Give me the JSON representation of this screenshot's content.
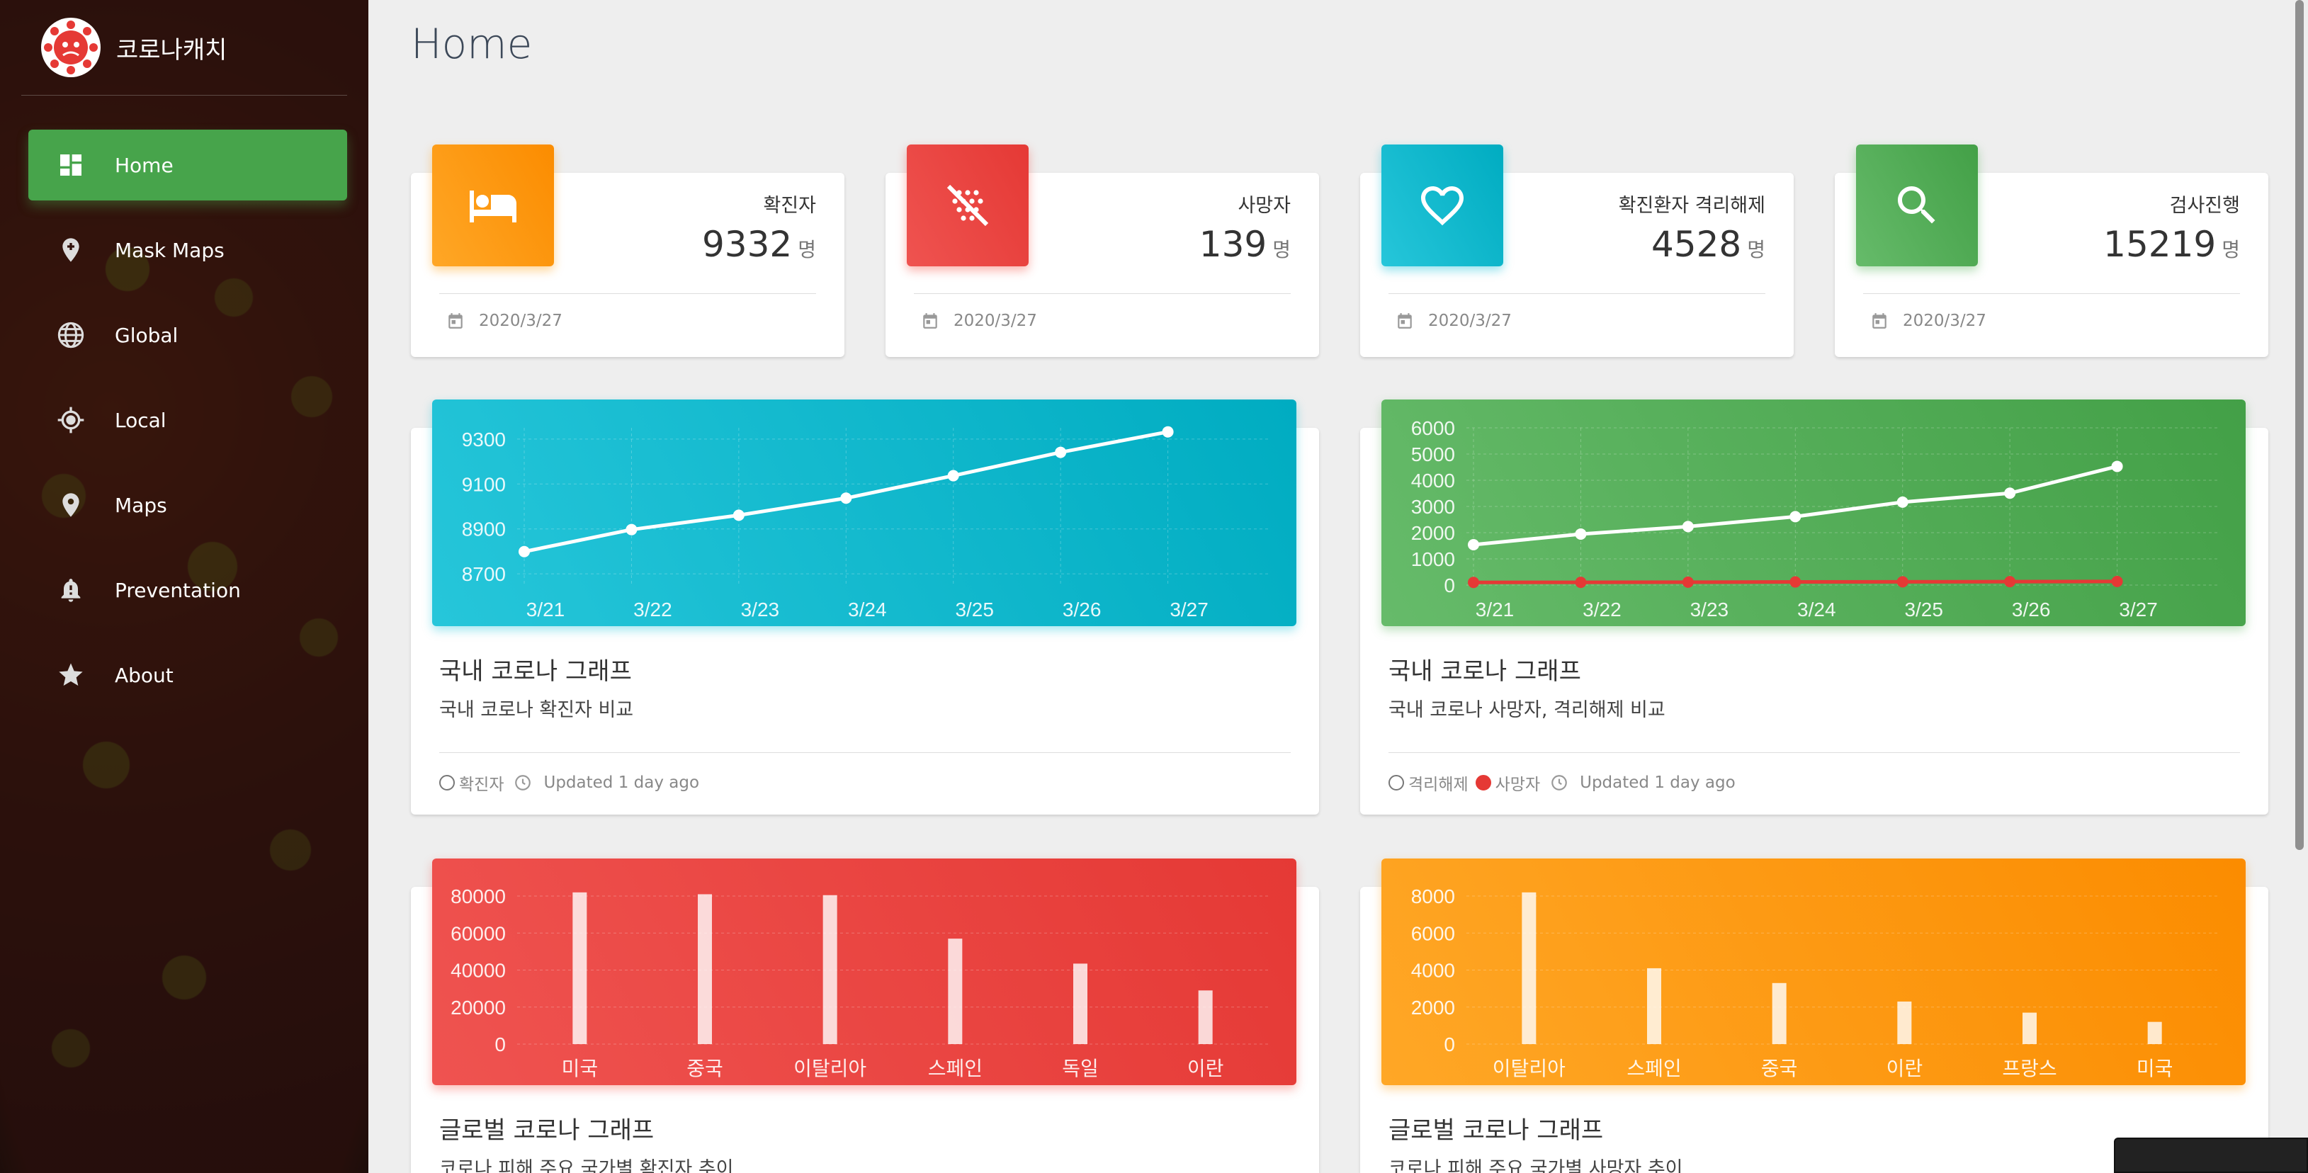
{
  "app": {
    "title": "코로나캐치"
  },
  "sidebar": {
    "items": [
      {
        "label": "Home",
        "icon": "dashboard-icon",
        "active": true
      },
      {
        "label": "Mask Maps",
        "icon": "mask-pin-icon"
      },
      {
        "label": "Global",
        "icon": "globe-icon"
      },
      {
        "label": "Local",
        "icon": "crosshair-icon"
      },
      {
        "label": "Maps",
        "icon": "map-pin-icon"
      },
      {
        "label": "Preventation",
        "icon": "warning-bell-icon"
      },
      {
        "label": "About",
        "icon": "star-icon"
      }
    ]
  },
  "page": {
    "title": "Home"
  },
  "stats": [
    {
      "label": "확진자",
      "value": "9332",
      "unit": "명",
      "date": "2020/3/27",
      "color": "#fb8c00",
      "icon": "bed-icon"
    },
    {
      "label": "사망자",
      "value": "139",
      "unit": "명",
      "date": "2020/3/27",
      "color": "#e53935",
      "icon": "virus-icon"
    },
    {
      "label": "확진환자 격리해제",
      "value": "4528",
      "unit": "명",
      "date": "2020/3/27",
      "color": "#26c6da",
      "icon": "heart-icon"
    },
    {
      "label": "검사진행",
      "value": "15219",
      "unit": "명",
      "date": "2020/3/27",
      "color": "#43a047",
      "icon": "search-icon"
    }
  ],
  "cards": [
    {
      "title": "국내 코로나 그래프",
      "subtitle": "국내 코로나 확진자 비교",
      "legend1": "확진자",
      "updated": "Updated 1 day ago"
    },
    {
      "title": "국내 코로나 그래프",
      "subtitle": "국내 코로나 사망자, 격리해제 비교",
      "legend1": "격리해제",
      "legend2": "사망자",
      "updated": "Updated 1 day ago"
    },
    {
      "title": "글로벌 코로나 그래프",
      "subtitle": "코로나 피해 주요 국가별 확진자 추이"
    },
    {
      "title": "글로벌 코로나 그래프",
      "subtitle": "코로나 피해 주요 국가별 사망자 추이"
    }
  ],
  "chart_data": [
    {
      "type": "line",
      "categories": [
        "3/21",
        "3/22",
        "3/23",
        "3/24",
        "3/25",
        "3/26",
        "3/27"
      ],
      "series": [
        {
          "values": [
            8799,
            8897,
            8961,
            9037,
            9137,
            9241,
            9332
          ]
        }
      ],
      "yticks": [
        8700,
        8900,
        9100,
        9300
      ],
      "ylim": [
        8650,
        9350
      ],
      "grid": true,
      "background": [
        "#26c6da",
        "#00acc1"
      ]
    },
    {
      "type": "line",
      "categories": [
        "3/21",
        "3/22",
        "3/23",
        "3/24",
        "3/25",
        "3/26",
        "3/27"
      ],
      "series": [
        {
          "name": "격리해제",
          "values": [
            1540,
            1947,
            2233,
            2612,
            3166,
            3507,
            4528
          ],
          "color": "#ffffff"
        },
        {
          "name": "사망자",
          "values": [
            102,
            104,
            111,
            120,
            126,
            131,
            139
          ],
          "color": "#e53935"
        }
      ],
      "yticks": [
        0,
        1000,
        2000,
        3000,
        4000,
        5000,
        6000
      ],
      "ylim": [
        0,
        6000
      ],
      "grid": true,
      "background": [
        "#66bb6a",
        "#43a047"
      ]
    },
    {
      "type": "bar",
      "categories": [
        "미국",
        "중국",
        "이탈리아",
        "스페인",
        "독일",
        "이란"
      ],
      "values": [
        82000,
        81000,
        80500,
        57000,
        43500,
        29000
      ],
      "yticks": [
        0,
        20000,
        40000,
        60000,
        80000
      ],
      "ylim": [
        0,
        85000
      ],
      "grid": true,
      "background": [
        "#ef5350",
        "#e53935"
      ]
    },
    {
      "type": "bar",
      "categories": [
        "이탈리아",
        "스페인",
        "중국",
        "이란",
        "프랑스",
        "미국"
      ],
      "values": [
        8200,
        4100,
        3300,
        2300,
        1700,
        1200
      ],
      "yticks": [
        0,
        2000,
        4000,
        6000,
        8000
      ],
      "ylim": [
        0,
        8500
      ],
      "grid": true,
      "background": [
        "#ffa726",
        "#fb8c00"
      ]
    }
  ]
}
